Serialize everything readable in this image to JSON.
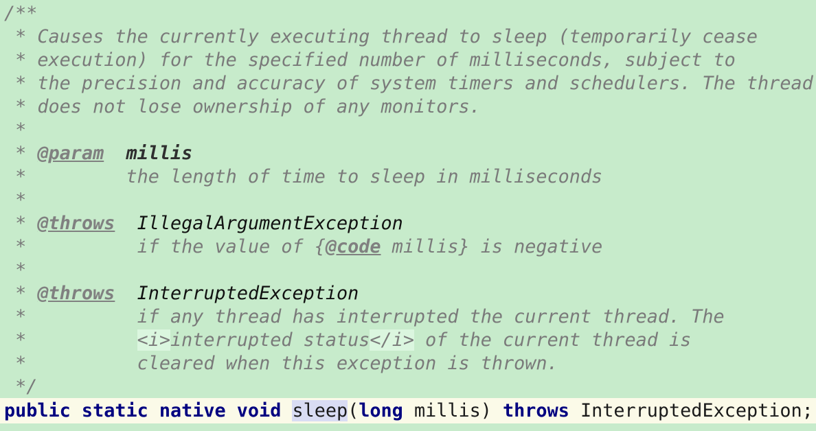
{
  "javadoc": {
    "open": "/**",
    "desc": [
      " * Causes the currently executing thread to sleep (temporarily cease",
      " * execution) for the specified number of milliseconds, subject to",
      " * the precision and accuracy of system timers and schedulers. The thread",
      " * does not lose ownership of any monitors."
    ],
    "star": " *",
    "star_indent": " *         ",
    "star_indent2": " *          ",
    "star_space": " * ",
    "param_tag": "@param",
    "param_name": "millis",
    "param_desc": "the length of time to sleep in milliseconds",
    "throws_tag": "@throws",
    "throws1_type": "IllegalArgumentException",
    "throws1_desc_pre": "if the value of {",
    "code_tag": "@code",
    "throws1_desc_post": " millis} is negative",
    "throws2_type": "InterruptedException",
    "throws2_desc1": "if any thread has interrupted the current thread. The",
    "i_open": "<i>",
    "throws2_desc2_mid": "interrupted status",
    "i_close": "</i>",
    "throws2_desc2_post": " of the current thread is",
    "throws2_desc3": "cleared when this exception is thrown.",
    "close": " */"
  },
  "signature": {
    "modifiers": "public static native void",
    "method": "sleep",
    "paren_open": "(",
    "param_type": "long",
    "param_name": " millis) ",
    "throws_kw": "throws",
    "exception": " InterruptedException;"
  }
}
